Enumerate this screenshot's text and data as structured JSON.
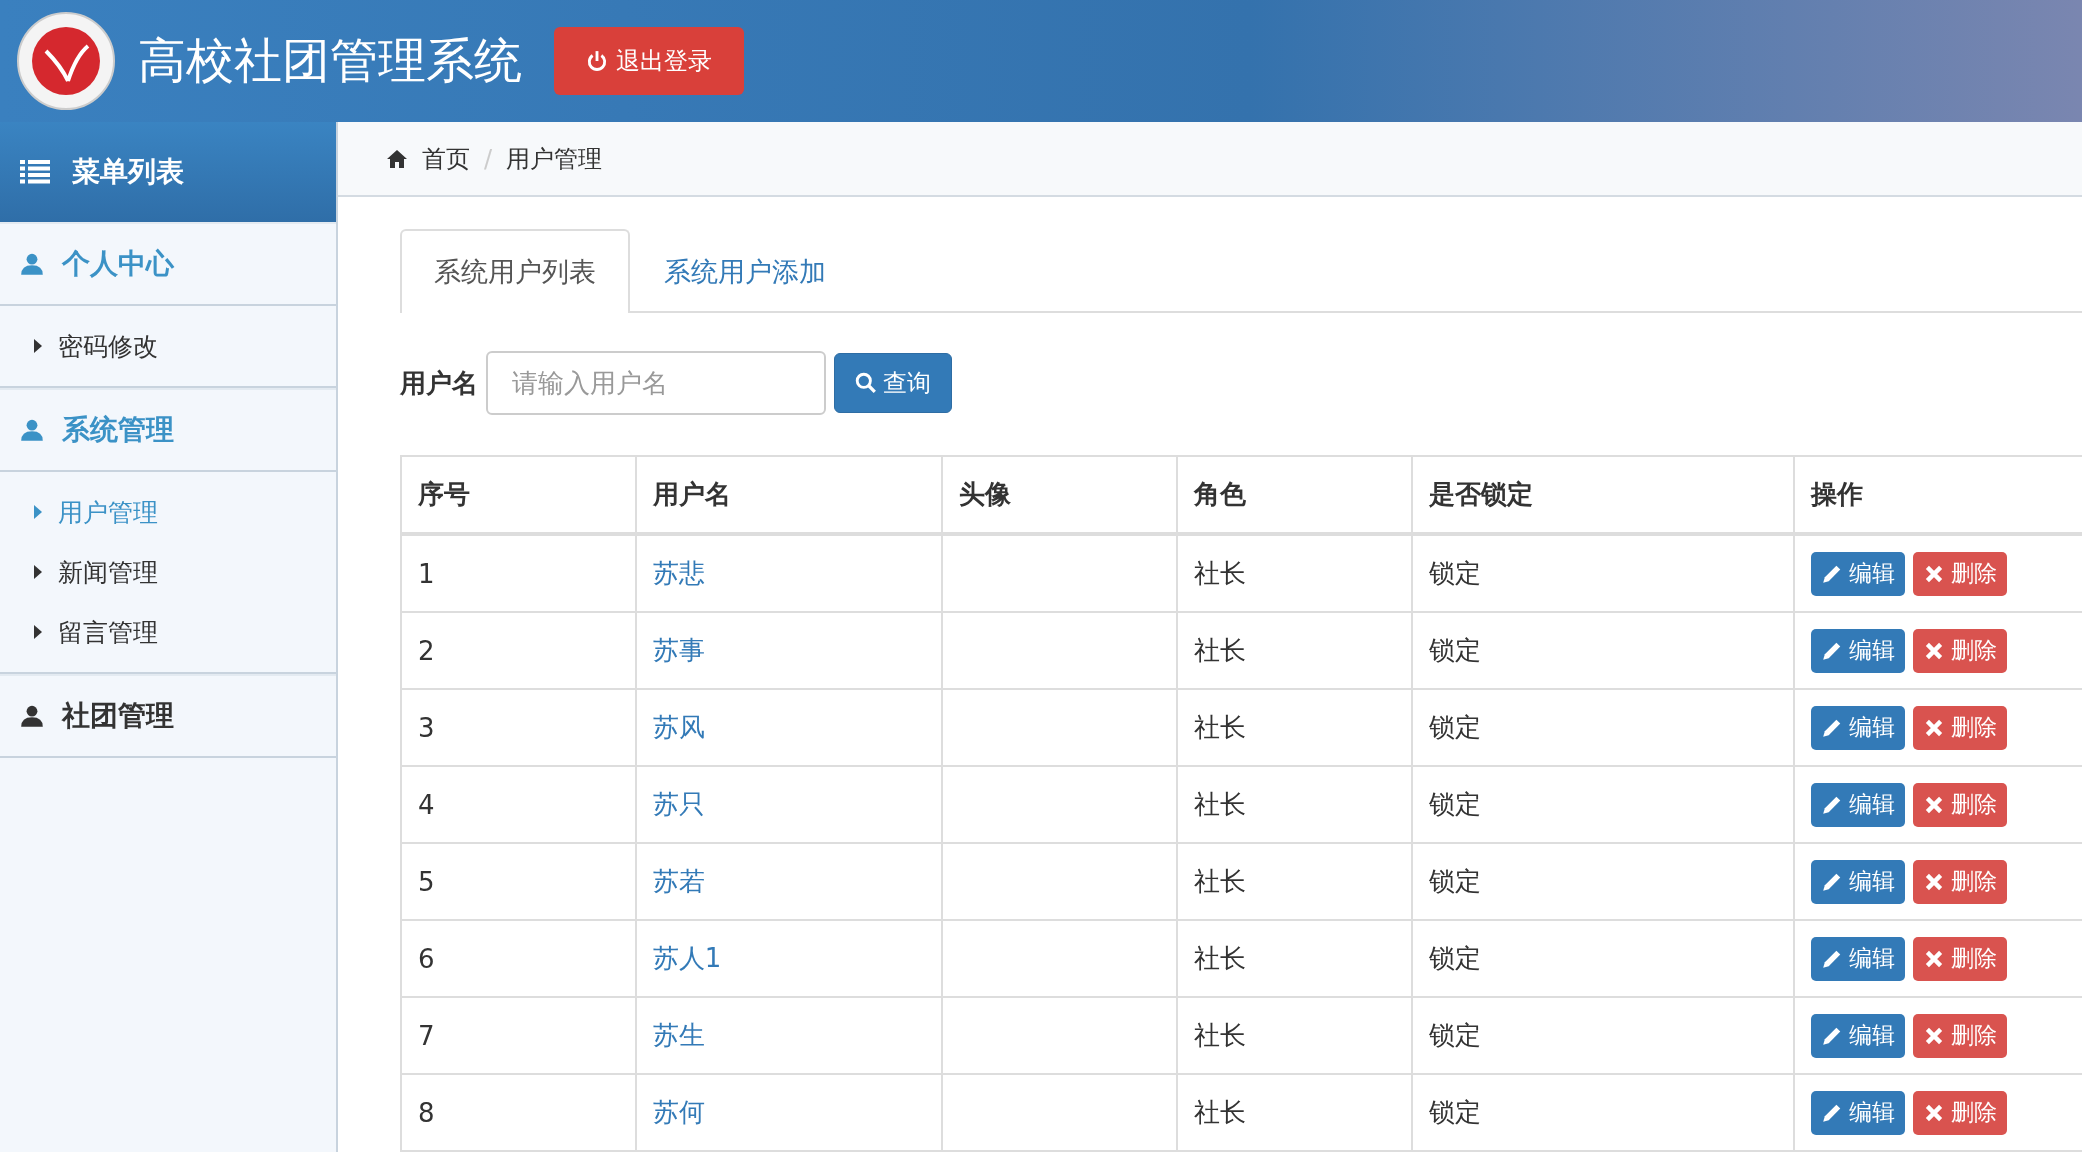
{
  "header": {
    "title": "高校社团管理系统",
    "logout": "退出登录"
  },
  "sidebar": {
    "title": "菜单列表",
    "groups": [
      {
        "label": "个人中心",
        "expanded": true,
        "items": [
          {
            "label": "密码修改",
            "selected": false
          }
        ]
      },
      {
        "label": "系统管理",
        "expanded": true,
        "items": [
          {
            "label": "用户管理",
            "selected": true
          },
          {
            "label": "新闻管理",
            "selected": false
          },
          {
            "label": "留言管理",
            "selected": false
          }
        ]
      },
      {
        "label": "社团管理",
        "expanded": false
      }
    ]
  },
  "breadcrumb": {
    "items": [
      "首页",
      "用户管理"
    ],
    "separator": "/"
  },
  "tabs": [
    {
      "label": "系统用户列表",
      "selected": true
    },
    {
      "label": "系统用户添加",
      "selected": false
    }
  ],
  "search": {
    "label": "用户名",
    "placeholder": "请输入用户名",
    "button": "查询"
  },
  "table": {
    "columns": [
      "序号",
      "用户名",
      "头像",
      "角色",
      "是否锁定",
      "操作"
    ],
    "rows": [
      {
        "index": "1",
        "username": "苏悲",
        "role": "社长",
        "locked": "锁定",
        "edit": "编辑",
        "delete": "删除"
      },
      {
        "index": "2",
        "username": "苏事",
        "role": "社长",
        "locked": "锁定",
        "edit": "编辑",
        "delete": "删除"
      },
      {
        "index": "3",
        "username": "苏风",
        "role": "社长",
        "locked": "锁定",
        "edit": "编辑",
        "delete": "删除"
      },
      {
        "index": "4",
        "username": "苏只",
        "role": "社长",
        "locked": "锁定",
        "edit": "编辑",
        "delete": "删除"
      },
      {
        "index": "5",
        "username": "苏若",
        "role": "社长",
        "locked": "锁定",
        "edit": "编辑",
        "delete": "删除"
      },
      {
        "index": "6",
        "username": "苏人1",
        "role": "社长",
        "locked": "锁定",
        "edit": "编辑",
        "delete": "删除"
      },
      {
        "index": "7",
        "username": "苏生",
        "role": "社长",
        "locked": "锁定",
        "edit": "编辑",
        "delete": "删除"
      },
      {
        "index": "8",
        "username": "苏何",
        "role": "社长",
        "locked": "锁定",
        "edit": "编辑",
        "delete": "删除"
      }
    ]
  }
}
